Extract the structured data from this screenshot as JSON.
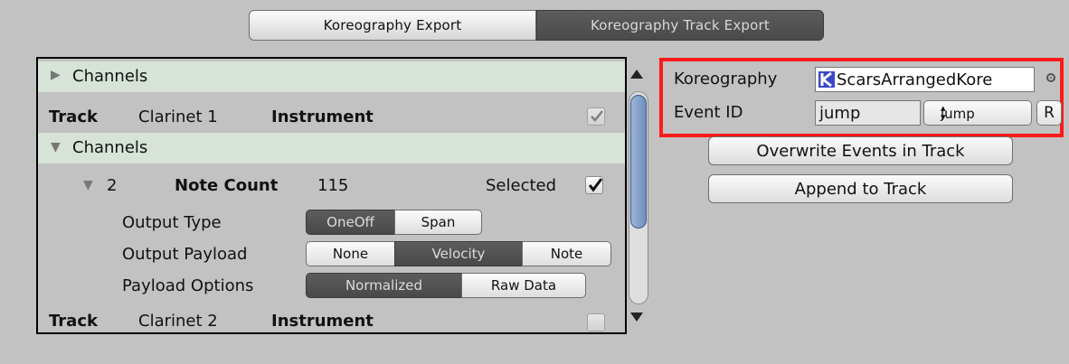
{
  "tabs": {
    "koreography_export": "Koreography Export",
    "track_export": "Koreography Track Export"
  },
  "tree": {
    "channels_collapsed": "Channels",
    "track1": {
      "key": "Track",
      "name": "Clarinet 1",
      "type": "Instrument",
      "checked": true
    },
    "channels_expanded": "Channels",
    "channel2": {
      "number": "2",
      "note_count_label": "Note Count",
      "note_count": "115",
      "selected_label": "Selected",
      "selected": true
    },
    "output_type": {
      "label": "Output Type",
      "options": [
        "OneOff",
        "Span"
      ],
      "active": "OneOff"
    },
    "output_payload": {
      "label": "Output Payload",
      "options": [
        "None",
        "Velocity",
        "Note"
      ],
      "active": "Velocity"
    },
    "payload_options": {
      "label": "Payload Options",
      "options": [
        "Normalized",
        "Raw Data"
      ],
      "active": "Normalized"
    },
    "track2": {
      "key": "Track",
      "name": "Clarinet 2",
      "type": "Instrument",
      "checked": false
    }
  },
  "koreography": {
    "label": "Koreography",
    "value": "ScarsArrangedKore"
  },
  "event_id": {
    "label": "Event ID",
    "value": "jump",
    "dropdown": "jump",
    "reset": "R"
  },
  "buttons": {
    "overwrite": "Overwrite Events in Track",
    "append": "Append to Track"
  },
  "colors": {
    "highlight_border": "#ff1a1a",
    "active_segment": "#4f4f4f",
    "channel_row": "#d6e3d6"
  }
}
